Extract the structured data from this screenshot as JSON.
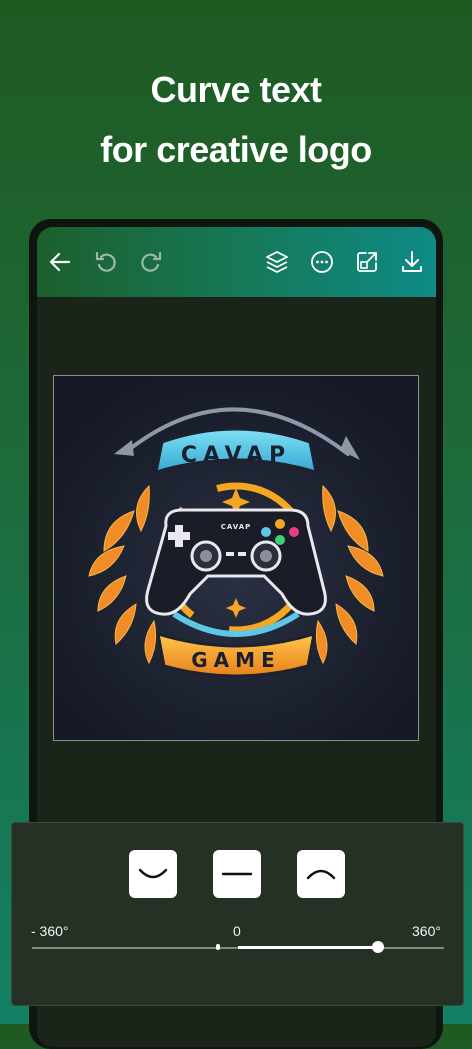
{
  "headline": {
    "line1": "Curve text",
    "line2": "for creative logo"
  },
  "toolbar": {
    "icons": [
      "back-arrow-icon",
      "undo-icon",
      "redo-icon",
      "layers-icon",
      "more-icon",
      "resize-icon",
      "download-icon"
    ]
  },
  "logo": {
    "top_text": "CAVAP",
    "bottom_text": "GAME",
    "controller_text": "CAVAP"
  },
  "curve_panel": {
    "options": [
      "curve-down",
      "straight",
      "curve-up"
    ],
    "slider": {
      "min_label": "- 360°",
      "mid_label": "0",
      "max_label": "360°",
      "value_fraction": 0.84
    }
  },
  "colors": {
    "accent_blue": "#5cc8e6",
    "accent_orange": "#f5a623",
    "bg_green_top": "#1f5a22",
    "bg_green_bottom": "#138064"
  }
}
